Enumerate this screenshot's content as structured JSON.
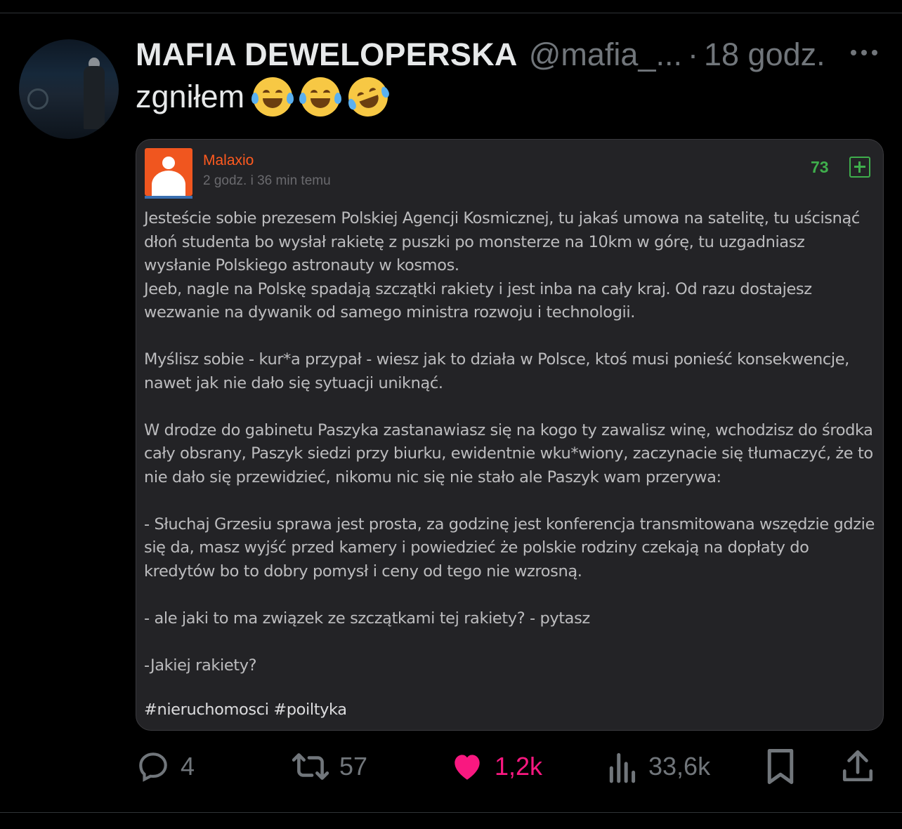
{
  "tweet": {
    "display_name": "MAFIA DEWELOPERSKA",
    "handle": "@mafia_...",
    "separator": "·",
    "time": "18 godz.",
    "text": "zgniłem",
    "emojis": [
      "face-with-tears-of-joy",
      "face-with-tears-of-joy",
      "rolling-on-the-floor-laughing"
    ]
  },
  "embedded_post": {
    "author": "Malaxio",
    "time": "2 godz. i 36 min temu",
    "votes": "73",
    "paragraphs": [
      "Jesteście sobie prezesem Polskiej Agencji Kosmicznej, tu jakaś umowa na satelitę, tu uścisnąć dłoń studenta bo wysłał rakietę z puszki po monsterze na 10km w górę, tu uzgadniasz wysłanie Polskiego astronauty w kosmos.",
      "Jeeb, nagle na Polskę spadają szczątki rakiety i jest inba na cały kraj. Od razu dostajesz wezwanie na dywanik od samego ministra rozwoju i technologii.",
      "Myślisz sobie - kur*a przypał - wiesz jak to działa w Polsce, ktoś musi ponieść konsekwencje, nawet jak nie dało się sytuacji uniknąć.",
      "W drodze do gabinetu Paszyka zastanawiasz się na kogo ty zawalisz winę, wchodzisz do środka cały obsrany, Paszyk siedzi przy biurku, ewidentnie wku*wiony, zaczynacie się tłumaczyć, że to nie dało się przewidzieć, nikomu nic się nie stało ale Paszyk wam przerywa:",
      "- Słuchaj Grzesiu sprawa jest prosta, za godzinę jest konferencja transmitowana wszędzie gdzie się da, masz wyjść przed kamery i powiedzieć że polskie rodziny czekają na dopłaty do kredytów bo to dobry pomysł i ceny od tego nie wzrosną.",
      "- ale jaki to ma związek ze szczątkami tej rakiety? - pytasz",
      "-Jakiej rakiety?"
    ],
    "tags": "#nieruchomosci #poiltyka"
  },
  "actions": {
    "reply_count": "4",
    "retweet_count": "57",
    "like_count": "1,2k",
    "views_count": "33,6k"
  },
  "colors": {
    "background": "#000000",
    "like_pink": "#f91880",
    "card_bg": "#232326",
    "author_orange": "#ff5a1f",
    "vote_green": "#3fae4c"
  }
}
